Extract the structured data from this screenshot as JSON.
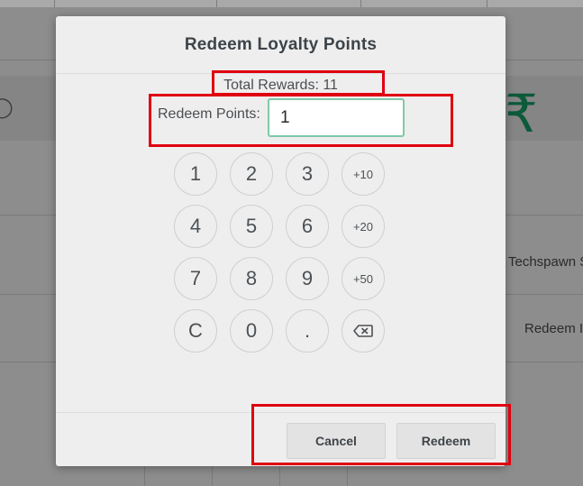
{
  "background": {
    "currency_symbol": "₹",
    "list_items": [
      {
        "label": "Techspawn S"
      },
      {
        "label": "Redeem I"
      }
    ]
  },
  "modal": {
    "title": "Redeem Loyalty Points",
    "total_rewards_text": "Total Rewards: 11",
    "redeem_points_label": "Redeem Points:",
    "redeem_points_value": "1",
    "keypad": {
      "keys": [
        "1",
        "2",
        "3",
        "+10",
        "4",
        "5",
        "6",
        "+20",
        "7",
        "8",
        "9",
        "+50",
        "C",
        "0",
        ".",
        "backspace"
      ]
    },
    "footer": {
      "cancel_label": "Cancel",
      "redeem_label": "Redeem"
    }
  },
  "colors": {
    "input_border": "#7fc9a8",
    "annotation": "#e0000f",
    "rupee": "#0d5a3a"
  },
  "icons": {
    "backspace": "backspace-icon"
  }
}
